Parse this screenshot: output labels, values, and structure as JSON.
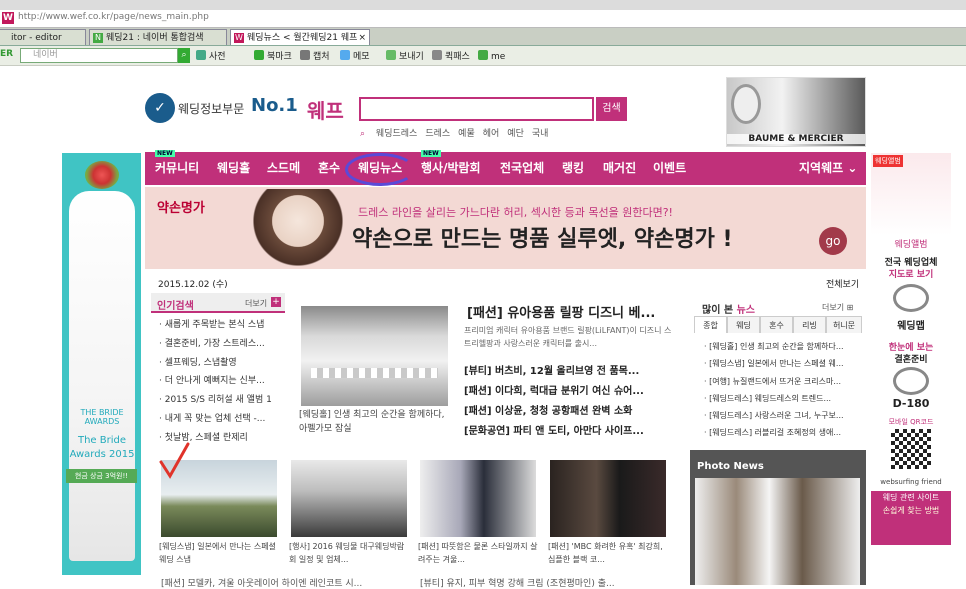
{
  "browser": {
    "url": "http://www.wef.co.kr/page/news_main.php",
    "tabs": [
      {
        "label": "itor - editor"
      },
      {
        "label": "웨딩21 : 네이버 통합검색"
      },
      {
        "label": "웨딩뉴스 < 월간웨딩21 웨프"
      }
    ],
    "search_placeholder": "네이버",
    "toolbar": [
      "사전",
      "북마크",
      "캡처",
      "메모",
      "보내기",
      "퀵패스",
      "me"
    ]
  },
  "header": {
    "logo_text": "웨딩정보부문",
    "logo_no": "No.1",
    "wepp": "웨프",
    "search_button": "검색",
    "hot_keywords": [
      "웨딩드레스",
      "드레스",
      "예물",
      "헤어",
      "예단",
      "국내"
    ],
    "brand_ad": "BAUME & MERCIER"
  },
  "nav": {
    "items": [
      "커뮤니티",
      "웨딩홀",
      "스드메",
      "혼수",
      "웨딩뉴스",
      "행사/박람회",
      "전국업체",
      "랭킹",
      "매거진",
      "이벤트"
    ],
    "new_badge": "NEW",
    "region": "지역웨프"
  },
  "banner": {
    "brand": "약손명가",
    "line1": "드레스 라인을 살리는 가느다란 허리, 섹시한 등과 목선을 원한다면?!",
    "line2": "약손으로 만드는 명품 실루엣, 약손명가 !",
    "go": "go"
  },
  "date": "2015.12.02 (수)",
  "all_view": "전체보기",
  "popular": {
    "title": "인기검색",
    "more": "더보기",
    "items": [
      "새롭게 주목받는 본식 스냅",
      "결혼준비, 가장 스트레스...",
      "셀프웨딩, 스냅촬영",
      "더 안나게 예뻐지는 신부...",
      "2015 S/S 리허설 새 앨범 1",
      "내게 꼭 맞는 업체 선택 -...",
      "첫날밤, 스페셜 란제리"
    ]
  },
  "main_article": {
    "caption": "[웨딩홀] 인생 최고의 순간을 함께하다, 아펠가모 잠실",
    "headline": "[패션] 유아용품 릴팡 디즈니 베...",
    "desc": "프리미엄 캐릭터 유아용품 브랜드 릴팡(LiLFANT)이 디즈니 스트리헬팡과 사랑스러운 캐릭터를 출시...",
    "news": [
      "[뷰티] 버츠비, 12월 올리브영 전 품목...",
      "[패션] 이다희, 럭대급 분위기 여신 슈어...",
      "[패션] 이상윤, 청청 공항패션 완벽 소화",
      "[문화공연] 파티 앤 도티, 아만다 사이프..."
    ]
  },
  "news_box": {
    "title_a": "많이 본",
    "title_b": "뉴스",
    "more": "더보기",
    "tabs": [
      "종합",
      "웨딩",
      "혼수",
      "리빙",
      "허니문"
    ],
    "items": [
      "[웨딩홀] 인생 최고의 순간을 함께하다...",
      "[웨딩스냅] 일본에서 만나는 스페셜 웨...",
      "[여행] 뉴질랜드에서 뜨거운 크리스마...",
      "[웨딩드레스] 웨딩드레스의 트렌드...",
      "[웨딩드레스] 사랑스러운 그녀, 누구보...",
      "[웨딩드레스] 러블리걸 조혜정의 생애..."
    ]
  },
  "thumbs": [
    {
      "caption": "[웨딩스냅] 일본에서 만나는 스페셜 웨딩 스냅"
    },
    {
      "caption": "[행사] 2016 웨딩물 대구웨딩박람회 일정 및 업체..."
    },
    {
      "caption": "[패션] 따뜻함은 물론 스타일까지 살려주는 겨울..."
    },
    {
      "caption": "[패션] 'MBC 화려한 유혹' 최강희, 심플한 블랙 코..."
    }
  ],
  "bottom_left": "[패션] 모델카, 겨울 아웃레이어 하이엔 레인코트 시...",
  "bottom_right": "[뷰티] 유지, 피부 혁명 강해 크림 (조현평마인) 출...",
  "photo_news": "Photo News",
  "left_ad": {
    "awards_small": "THE BRIDE AWARDS",
    "awards_big": "The Bride Awards 2015",
    "coupon": "현금 상금 3억원!!"
  },
  "right_ad": {
    "badge": "웨딩앨범",
    "album": "웨딩앨범",
    "map_t1": "전국 웨딩업체",
    "map_t2": "지도로 보기",
    "map_label": "웨딩맵",
    "dday_t1": "한눈에 보는",
    "dday_t2": "결혼준비",
    "dday_label": "D-180",
    "qr_label": "모바일 QR코드",
    "wf": "websurfing friend",
    "wf_t1": "웨딩 관련 사이트",
    "wf_t2": "손쉽게 찾는 방법"
  }
}
